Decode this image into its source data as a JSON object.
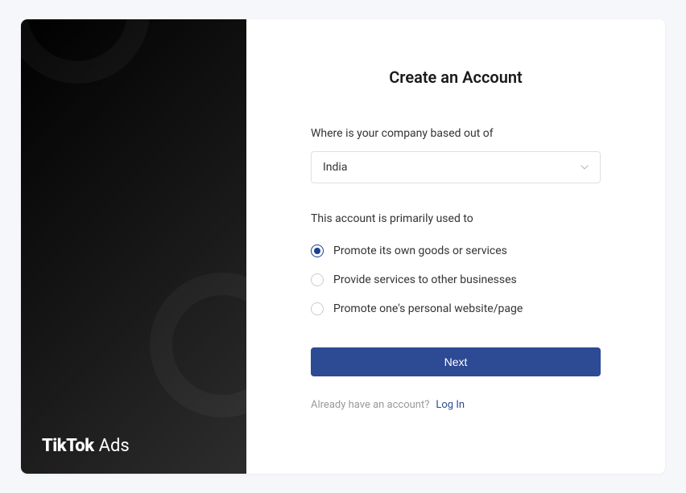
{
  "brand": {
    "logo_primary": "TikTok",
    "logo_secondary": "Ads"
  },
  "form": {
    "title": "Create an Account",
    "company_location": {
      "label": "Where is your company based out of",
      "value": "India"
    },
    "account_usage": {
      "label": "This account is primarily used to",
      "options": [
        {
          "label": "Promote its own goods or services",
          "selected": true
        },
        {
          "label": "Provide services to other businesses",
          "selected": false
        },
        {
          "label": "Promote one's personal website/page",
          "selected": false
        }
      ]
    },
    "next_button": "Next",
    "login": {
      "prompt": "Already have an account?",
      "link": "Log In"
    }
  }
}
